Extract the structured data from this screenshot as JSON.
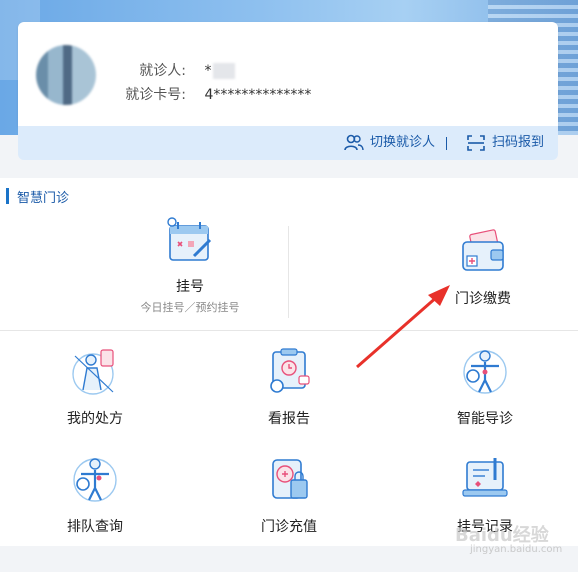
{
  "patient": {
    "name_label": "就诊人:",
    "name_value": "*",
    "card_label": "就诊卡号:",
    "card_value": "4**************"
  },
  "actions": {
    "switch_label": "切换就诊人",
    "scan_label": "扫码报到"
  },
  "section": {
    "title": "智慧门诊"
  },
  "tiles": {
    "register": {
      "label": "挂号",
      "sub": "今日挂号／预约挂号"
    },
    "payment": {
      "label": "门诊缴费"
    },
    "prescription": {
      "label": "我的处方"
    },
    "report": {
      "label": "看报告"
    },
    "guide": {
      "label": "智能导诊"
    },
    "queue": {
      "label": "排队查询"
    },
    "recharge": {
      "label": "门诊充值"
    },
    "records": {
      "label": "挂号记录"
    }
  },
  "watermark": {
    "text": "Baidu经验",
    "url_text": "jingyan.baidu.com"
  },
  "colors": {
    "accent": "#1a73c8",
    "arrow": "#e8312a",
    "action_bg": "#dcebfb"
  }
}
